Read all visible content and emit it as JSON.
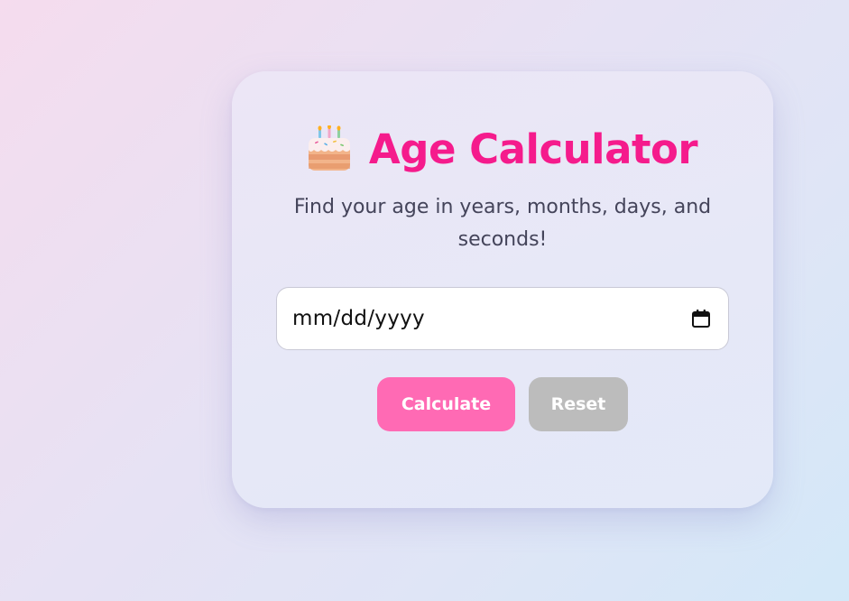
{
  "app": {
    "title": "Age Calculator",
    "subtitle": "Find your age in years, months, days, and seconds!",
    "title_icon": "cake-icon"
  },
  "form": {
    "birthdate": {
      "placeholder": "mm/dd/yyyy",
      "value": "",
      "icon": "calendar-icon"
    },
    "calculate_label": "Calculate",
    "reset_label": "Reset"
  },
  "colors": {
    "title": "#f51b8c",
    "calculate_button": "#ff6ab4",
    "reset_button": "#bcbcbc",
    "subtitle_text": "#44445a"
  }
}
